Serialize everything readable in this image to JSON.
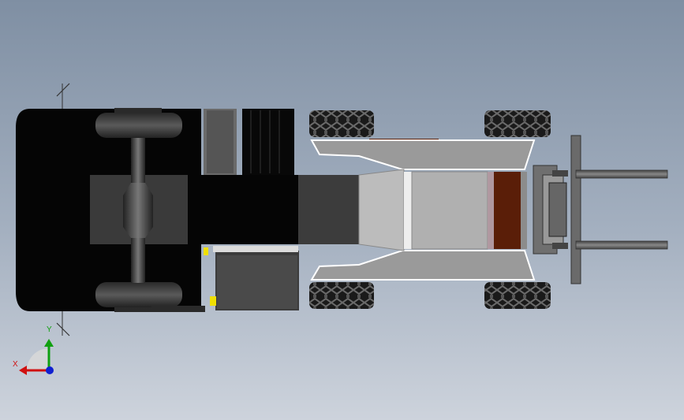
{
  "app": {
    "title": "",
    "view_orientation": "top"
  },
  "model": {
    "name": "",
    "colors": {
      "background_top": "#7f8fa3",
      "background_bottom": "#cdd3dc",
      "tire": "#111111",
      "body": "#050505",
      "frame_light": "#c8c8c8",
      "frame_mid": "#9a9a9a",
      "counter_panel": "#5a1e08",
      "accent_yellow": "#f0e000"
    }
  },
  "triad": {
    "x_label": "X",
    "y_label": "Y",
    "x_color": "#d01010",
    "y_color": "#10a010",
    "z_color": "#1020d0"
  }
}
